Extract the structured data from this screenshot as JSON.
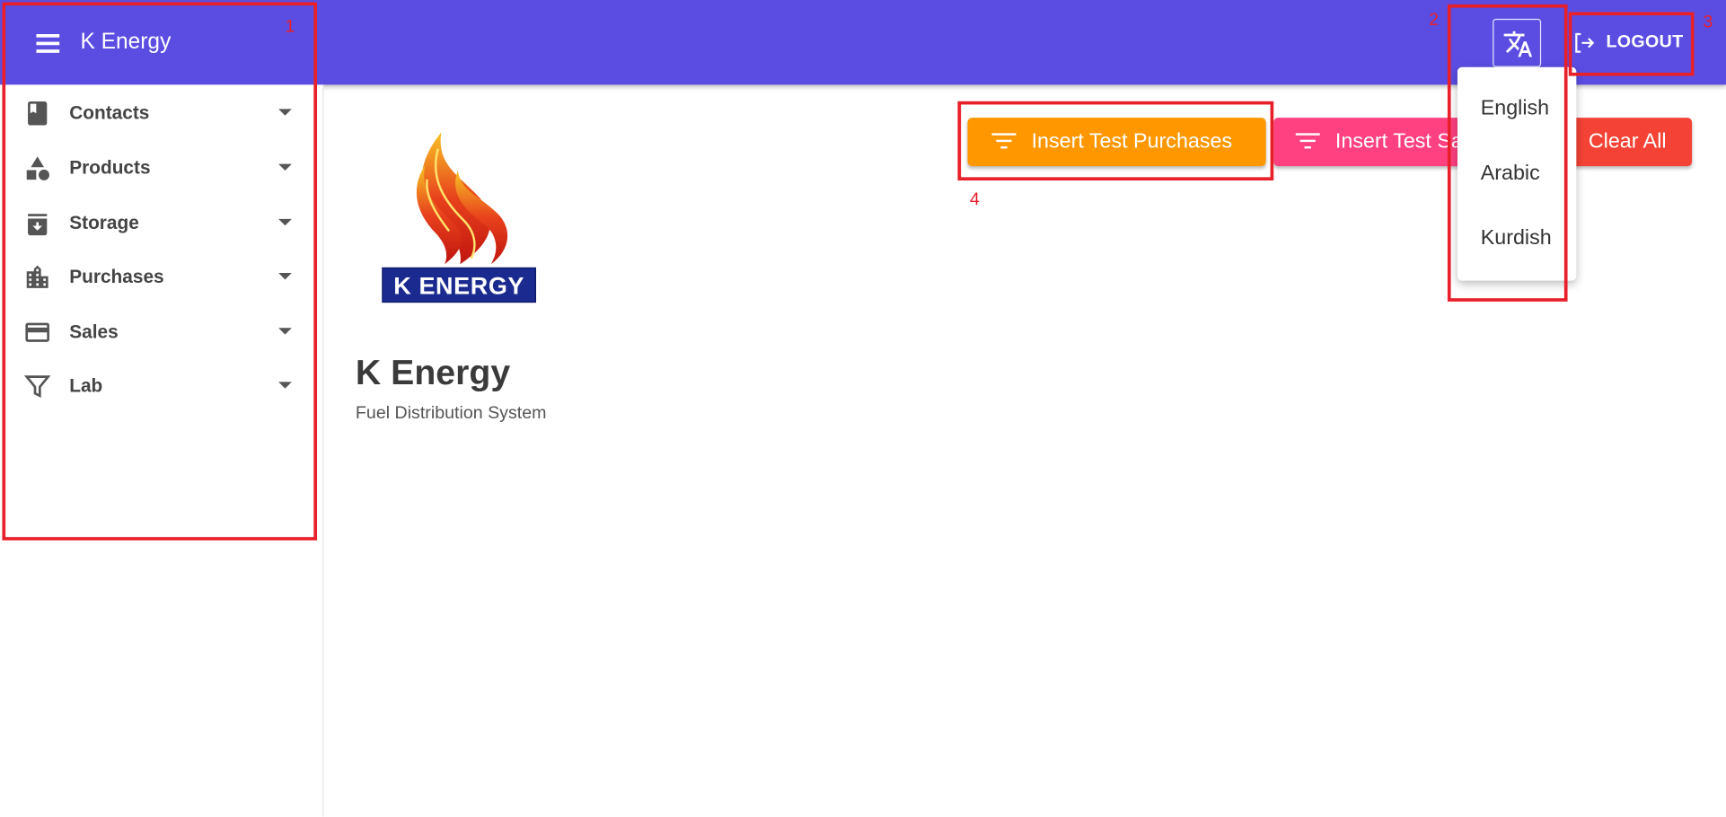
{
  "appbar": {
    "title": "K Energy",
    "logout_label": "LOGOUT",
    "background_color": "#5b4de2"
  },
  "sidebar": {
    "items": [
      {
        "label": "Contacts",
        "icon": "contacts-book-icon"
      },
      {
        "label": "Products",
        "icon": "category-shapes-icon"
      },
      {
        "label": "Storage",
        "icon": "archive-box-icon"
      },
      {
        "label": "Purchases",
        "icon": "buildings-icon"
      },
      {
        "label": "Sales",
        "icon": "credit-card-icon"
      },
      {
        "label": "Lab",
        "icon": "filter-funnel-icon"
      }
    ]
  },
  "main": {
    "logo_text": "K ENERGY",
    "title": "K Energy",
    "subtitle": "Fuel Distribution System",
    "buttons": {
      "insert_purchases": "Insert Test Purchases",
      "insert_sales": "Insert Test Sales",
      "clear_all": "Clear All"
    },
    "button_colors": {
      "insert_purchases": "#ff9800",
      "insert_sales": "#ff4081",
      "clear_all": "#f44336"
    }
  },
  "language_menu": {
    "options": [
      "English",
      "Arabic",
      "Kurdish"
    ]
  },
  "annotations": {
    "labels": [
      "1",
      "2",
      "3",
      "4"
    ],
    "color": "#e8202a"
  }
}
